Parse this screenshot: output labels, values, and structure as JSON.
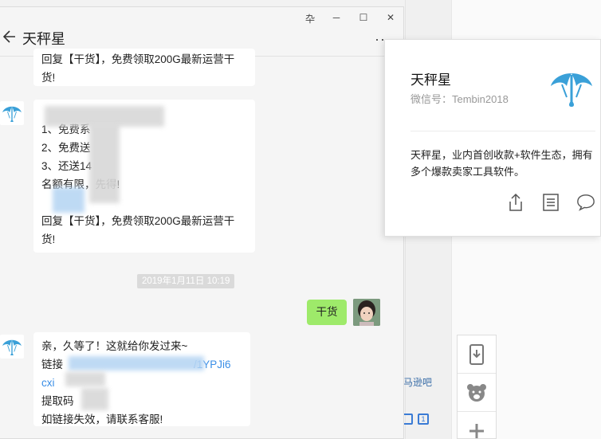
{
  "chat": {
    "title": "天秤星",
    "window_controls": {
      "pin": "卆",
      "minimize": "─",
      "maximize": "☐",
      "close": "✕"
    },
    "more": "···"
  },
  "messages": {
    "msg0": {
      "line1": "回复【干货】，免费领取200G最新运营干",
      "line2": "货!"
    },
    "msg1": {
      "lines": [
        "1、免费系",
        "2、免费送",
        "3、还送14",
        "名额有限，先得!",
        ""
      ],
      "footer1": "回复【干货】，免费领取200G最新运营干",
      "footer2": "货!"
    },
    "timestamp": "2019年1月11日 10:19",
    "my_message": "干货",
    "msg2": {
      "line1": "亲，久等了！这就给你发过来~",
      "line2_prefix": "链接",
      "line2_link": "/1YPJi6",
      "line3_link": "cxi",
      "line4": "提取码",
      "line5": "如链接失效，请联系客服!"
    }
  },
  "profile": {
    "name": "天秤星",
    "wechat_id": "微信号：Tembin2018",
    "description": "天秤星，业内首创收款+软件生态，拥有多个爆款卖家工具软件。"
  },
  "background": {
    "link_text": "马逊吧"
  },
  "colors": {
    "my_bubble": "#9eea6a",
    "link": "#3a8ee6",
    "logo": "#3aa0d8"
  },
  "icons": {
    "back": "back-arrow-icon",
    "share": "share-icon",
    "document": "document-icon",
    "chat": "chat-icon",
    "logo": "scale-logo-icon"
  }
}
